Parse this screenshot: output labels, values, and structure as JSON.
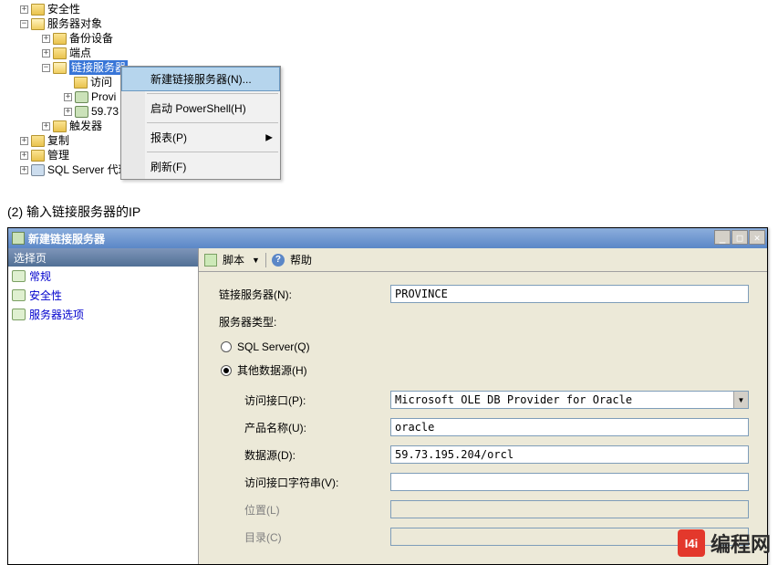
{
  "tree": {
    "security": "安全性",
    "server_objects": "服务器对象",
    "backup": "备份设备",
    "endpoint": "端点",
    "linked_servers": "链接服务器",
    "providers": "访问",
    "provi": "Provi",
    "ip_partial": "59.73",
    "triggers": "触发器",
    "replication": "复制",
    "management": "管理",
    "sql_agent": "SQL Server 代理"
  },
  "context": {
    "new_linked": "新建链接服务器(N)...",
    "start_ps": "启动 PowerShell(H)",
    "reports": "报表(P)",
    "refresh": "刷新(F)"
  },
  "instr": "(2)  输入链接服务器的IP",
  "dialog": {
    "title": "新建链接服务器",
    "left_header": "选择页",
    "left_items": {
      "general": "常规",
      "security": "安全性",
      "server_opts": "服务器选项"
    },
    "toolbar": {
      "script": "脚本",
      "help": "帮助"
    },
    "form": {
      "linked_server_label": "链接服务器(N):",
      "linked_server_value": "PROVINCE",
      "server_type_label": "服务器类型:",
      "radio_sqlserver": "SQL Server(Q)",
      "radio_other": "其他数据源(H)",
      "provider_label": "访问接口(P):",
      "provider_value": "Microsoft OLE DB Provider for Oracle",
      "product_label": "产品名称(U):",
      "product_value": "oracle",
      "datasource_label": "数据源(D):",
      "datasource_value": "59.73.195.204/orcl",
      "provstring_label": "访问接口字符串(V):",
      "provstring_value": "",
      "location_label": "位置(L)",
      "location_value": "",
      "catalog_label": "目录(C)",
      "catalog_value": ""
    }
  },
  "watermark": {
    "logo": "I4i",
    "text": "编程网"
  }
}
